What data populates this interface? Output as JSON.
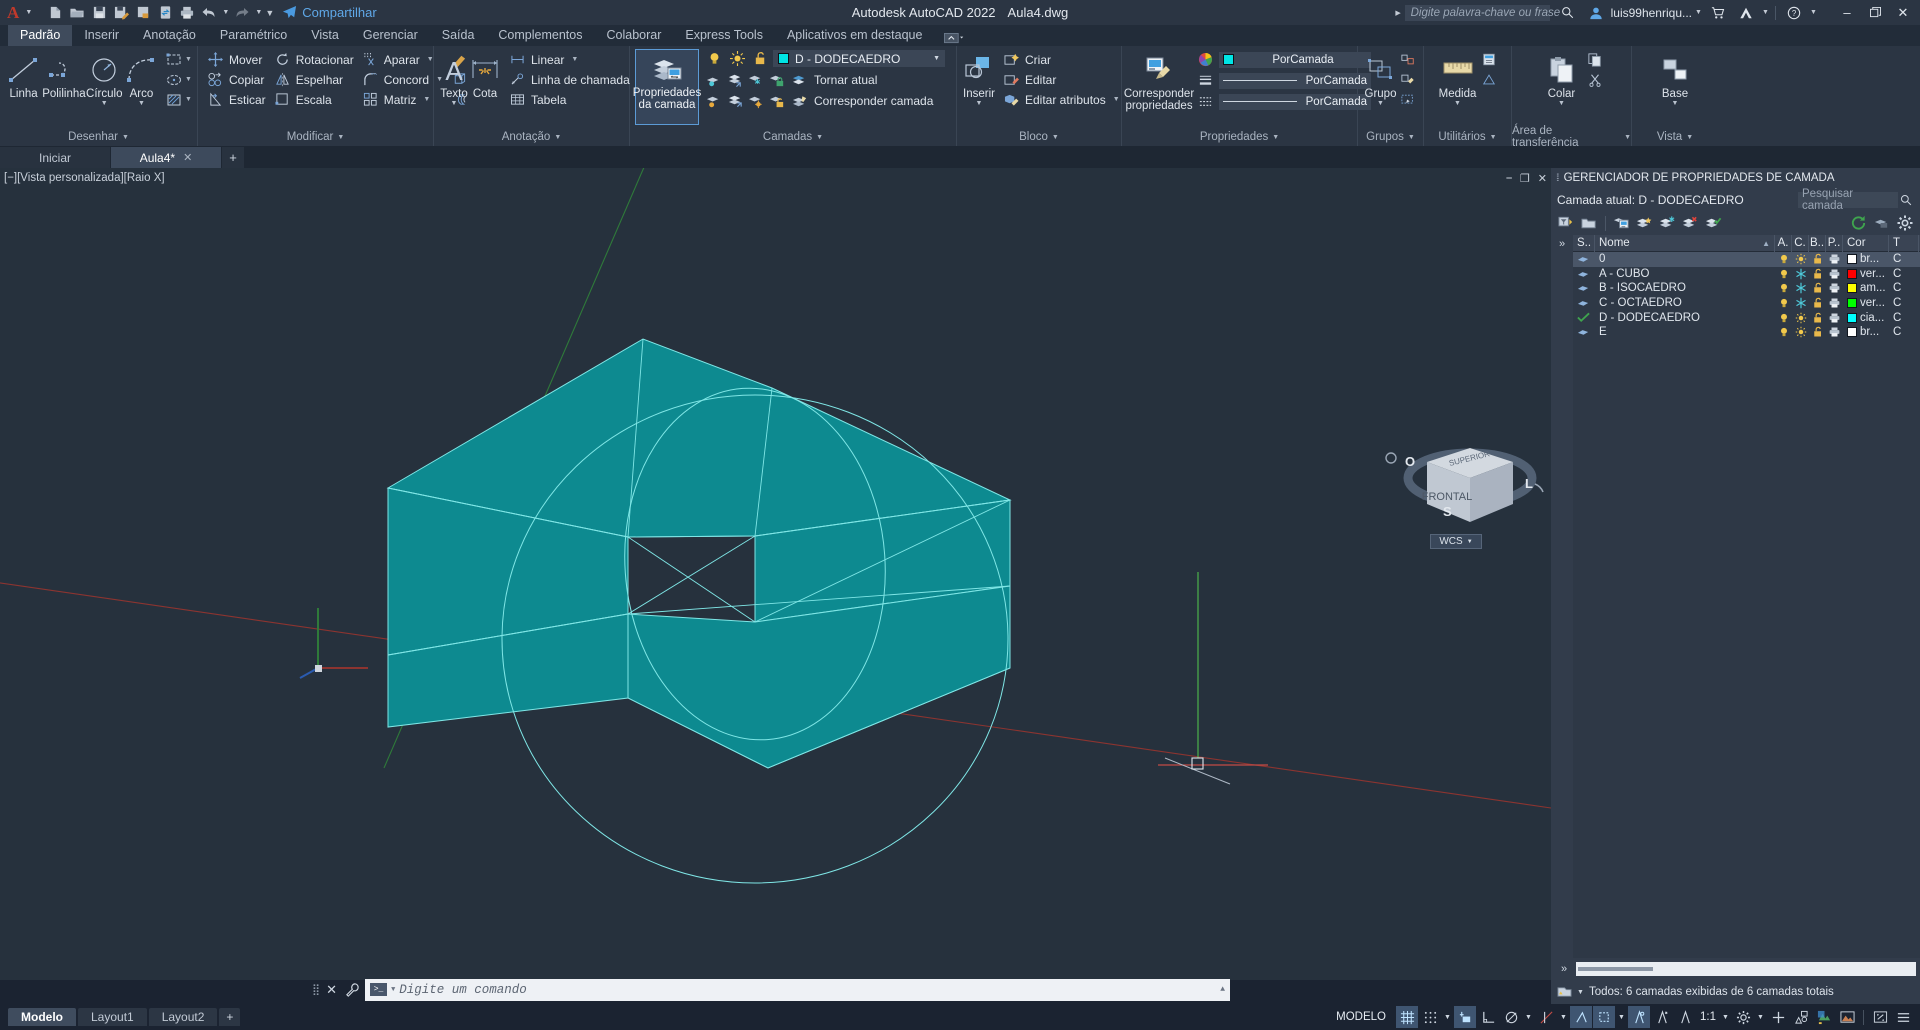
{
  "app": {
    "title": "Autodesk AutoCAD 2022",
    "document": "Aula4.dwg"
  },
  "quick_access": {
    "share_label": "Compartilhar",
    "icons": [
      "new-icon",
      "open-icon",
      "save-icon",
      "saveas-icon",
      "plot-preview-icon",
      "sync-icon",
      "print-icon",
      "undo-icon",
      "redo-icon",
      "more-icon"
    ]
  },
  "search": {
    "placeholder": "Digite palavra-chave ou frase"
  },
  "account": {
    "user": "luis99henriqu...",
    "icons": [
      "search-icon",
      "user-icon",
      "cart-icon",
      "autodesk-icon",
      "help-icon"
    ]
  },
  "window_controls": {
    "minimize": "–",
    "maximize": "❐",
    "close": "✕"
  },
  "ribbon_tabs": [
    {
      "label": "Padrão",
      "active": true
    },
    {
      "label": "Inserir",
      "active": false
    },
    {
      "label": "Anotação",
      "active": false
    },
    {
      "label": "Paramétrico",
      "active": false
    },
    {
      "label": "Vista",
      "active": false
    },
    {
      "label": "Gerenciar",
      "active": false
    },
    {
      "label": "Saída",
      "active": false
    },
    {
      "label": "Complementos",
      "active": false
    },
    {
      "label": "Colaborar",
      "active": false
    },
    {
      "label": "Express Tools",
      "active": false
    },
    {
      "label": "Aplicativos em destaque",
      "active": false
    }
  ],
  "ribbon": {
    "desenhar": {
      "title": "Desenhar",
      "big": [
        {
          "label": "Linha",
          "icon": "line-icon"
        },
        {
          "label": "Polilinha",
          "icon": "polyline-icon"
        },
        {
          "label": "Círculo",
          "icon": "circle-icon",
          "dropdown": true
        },
        {
          "label": "Arco",
          "icon": "arc-icon",
          "dropdown": true
        }
      ],
      "small": [
        {
          "icon": "rectangle-icon"
        },
        {
          "icon": "ellipse-icon"
        },
        {
          "icon": "hatch-icon"
        }
      ]
    },
    "modificar": {
      "title": "Modificar",
      "items": [
        {
          "label": "Mover",
          "icon": "move-icon"
        },
        {
          "label": "Rotacionar",
          "icon": "rotate-icon"
        },
        {
          "label": "Aparar",
          "icon": "trim-icon",
          "dropdown": true
        },
        {
          "label": "Copiar",
          "icon": "copy-icon"
        },
        {
          "label": "Espelhar",
          "icon": "mirror-icon"
        },
        {
          "label": "Concord",
          "icon": "fillet-icon",
          "dropdown": true
        },
        {
          "label": "Esticar",
          "icon": "stretch-icon"
        },
        {
          "label": "Escala",
          "icon": "scale-icon"
        },
        {
          "label": "Matriz",
          "icon": "array-icon",
          "dropdown": true
        }
      ],
      "extra_icons": [
        "erase-icon",
        "3dsolid-icon",
        "offset-icon"
      ]
    },
    "anotacao": {
      "title": "Anotação",
      "big": [
        {
          "label": "Texto",
          "icon": "text-icon",
          "dropdown": true
        },
        {
          "label": "Cota",
          "icon": "dimension-icon"
        }
      ],
      "small": [
        {
          "label": "Linear",
          "icon": "linear-dim-icon",
          "dropdown": true
        },
        {
          "label": "Linha de chamada",
          "icon": "leader-icon",
          "dropdown": true
        },
        {
          "label": "Tabela",
          "icon": "table-icon"
        }
      ]
    },
    "camadas": {
      "title": "Camadas",
      "main_button": "Propriedades da camada",
      "layer_dropdown": {
        "value": "D - DODECAEDRO",
        "color": "#00e5e5"
      },
      "actions": [
        {
          "label": "Tornar atual",
          "icon": "make-current-icon"
        },
        {
          "label": "Corresponder camada",
          "icon": "match-layer-icon"
        }
      ],
      "state_icons": [
        "lightbulb-icon",
        "sun-icon",
        "unlock-icon"
      ]
    },
    "bloco": {
      "title": "Bloco",
      "big": {
        "label": "Inserir",
        "icon": "insert-block-icon",
        "dropdown": true
      },
      "items": [
        {
          "label": "Criar",
          "icon": "create-block-icon"
        },
        {
          "label": "Editar",
          "icon": "edit-block-icon"
        },
        {
          "label": "Editar atributos",
          "icon": "edit-attributes-icon",
          "dropdown": true
        }
      ]
    },
    "propriedades": {
      "title": "Propriedades",
      "big": {
        "label": "Corresponder propriedades",
        "icon": "match-properties-icon"
      },
      "rows": [
        {
          "label": "PorCamada",
          "icon": "color-wheel-icon",
          "swatch": "#00e5e5"
        },
        {
          "label": "PorCamada",
          "icon": "linewidth-icon"
        },
        {
          "label": "PorCamada",
          "icon": "linetype-icon"
        }
      ]
    },
    "grupos": {
      "title": "Grupos",
      "label": "Grupo"
    },
    "utilitarios": {
      "title": "Utilitários",
      "label": "Medida"
    },
    "area_transf": {
      "title": "Área de transferência",
      "label": "Colar"
    },
    "vista": {
      "title": "Vista",
      "label": "Base"
    }
  },
  "doc_tabs": [
    {
      "label": "Iniciar",
      "active": false,
      "closable": false
    },
    {
      "label": "Aula4*",
      "active": true,
      "closable": true
    }
  ],
  "viewport": {
    "label": "[−][Vista personalizada][Raio X]",
    "controls": [
      "minimize-icon",
      "maximize-icon",
      "close-icon"
    ],
    "wcs_label": "WCS",
    "viewcube": {
      "top": "SUPERIOR",
      "front": "FRONTAL",
      "compass": [
        "O",
        "L",
        "S"
      ]
    }
  },
  "command_line": {
    "placeholder": "Digite um comando",
    "icons": [
      "grip-icon",
      "close-icon",
      "wrench-icon",
      "prompt-icon"
    ]
  },
  "layout_tabs": [
    {
      "label": "Modelo",
      "active": true
    },
    {
      "label": "Layout1",
      "active": false
    },
    {
      "label": "Layout2",
      "active": false
    },
    {
      "label": "+",
      "active": false
    }
  ],
  "status_bar": {
    "model_label": "MODELO",
    "scale": "1:1",
    "items": [
      {
        "name": "grid-toggle",
        "on": true
      },
      {
        "name": "snap-toggle",
        "on": false
      },
      {
        "name": "infer-constraints",
        "on": true
      },
      {
        "name": "ortho-toggle",
        "on": false
      },
      {
        "name": "polar-tracking",
        "on": false
      },
      {
        "name": "osnap-toggle",
        "on": false
      },
      {
        "name": "object-snap",
        "on": true
      },
      {
        "name": "ucs-icon",
        "on": true
      },
      {
        "name": "dynamic-ucs",
        "on": false
      },
      {
        "name": "dynamic-input",
        "on": false
      },
      {
        "name": "annotation-scale",
        "on": false
      },
      {
        "name": "workspace-gear",
        "on": false
      },
      {
        "name": "customization",
        "on": false
      },
      {
        "name": "isolate-objects",
        "on": false
      },
      {
        "name": "hardware-accel",
        "on": false
      },
      {
        "name": "clean-screen",
        "on": false
      },
      {
        "name": "menu-icon",
        "on": false
      }
    ]
  },
  "layer_manager": {
    "title": "GERENCIADOR DE PROPRIEDADES DE CAMADA",
    "current_layer_label": "Camada atual: D - DODECAEDRO",
    "search_placeholder": "Pesquisar camada",
    "toolbar_icons": [
      "new-layer-icon",
      "new-layer-vp-icon",
      "delete-layer-icon",
      "set-current-icon",
      "new-filter-icon",
      "new-group-filter-icon",
      "layer-states-icon",
      "refresh-icon",
      "settings-icon"
    ],
    "columns": [
      "S..",
      "Nome",
      "A.",
      "C.",
      "B..",
      "P..",
      "Cor",
      "T"
    ],
    "rows": [
      {
        "status": "layer",
        "name": "0",
        "on": true,
        "freeze": false,
        "lock": false,
        "plot": true,
        "color_name": "br...",
        "color": "#ffffff",
        "selected": true
      },
      {
        "status": "layer",
        "name": "A - CUBO",
        "on": true,
        "freeze": true,
        "lock": false,
        "plot": true,
        "color_name": "ver...",
        "color": "#ff0000",
        "selected": false
      },
      {
        "status": "layer",
        "name": "B - ISOCAEDRO",
        "on": true,
        "freeze": true,
        "lock": false,
        "plot": true,
        "color_name": "am...",
        "color": "#ffff00",
        "selected": false
      },
      {
        "status": "layer",
        "name": "C - OCTAEDRO",
        "on": true,
        "freeze": true,
        "lock": false,
        "plot": true,
        "color_name": "ver...",
        "color": "#00ff00",
        "selected": false
      },
      {
        "status": "current",
        "name": "D - DODECAEDRO",
        "on": true,
        "freeze": false,
        "lock": false,
        "plot": true,
        "color_name": "cia...",
        "color": "#00ffff",
        "selected": false
      },
      {
        "status": "layer",
        "name": "E",
        "on": true,
        "freeze": false,
        "lock": false,
        "plot": true,
        "color_name": "br...",
        "color": "#ffffff",
        "selected": false
      }
    ],
    "status_text": "Todos: 6 camadas exibidas de 6 camadas totais"
  },
  "colors": {
    "accent": "#5c9bd6",
    "canvas_bg": "#26313d",
    "model_teal": "#0f8c92",
    "model_edge": "#7fe6e6",
    "axis_red": "#b8433f",
    "axis_green": "#3f8f4a"
  }
}
